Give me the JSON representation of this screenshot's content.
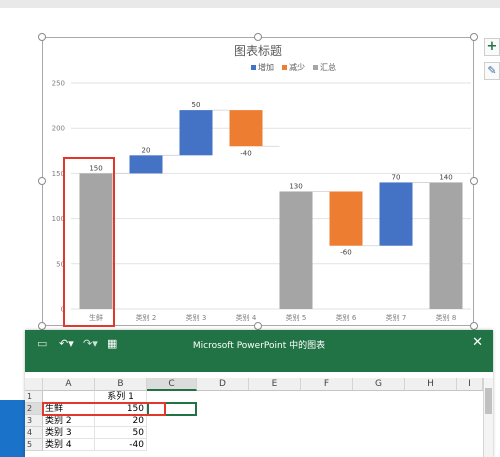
{
  "chart": {
    "title": "图表标题",
    "legend": [
      {
        "label": "增加",
        "color": "#4472c4"
      },
      {
        "label": "减少",
        "color": "#ed7d31"
      },
      {
        "label": "汇总",
        "color": "#a5a5a5"
      }
    ]
  },
  "chart_data": {
    "type": "bar",
    "subtype": "waterfall",
    "title": "图表标题",
    "ylim": [
      0,
      250
    ],
    "yticks": [
      0,
      50,
      100,
      150,
      200,
      250
    ],
    "grid": true,
    "legend_position": "top",
    "categories": [
      "生鲜",
      "类别 2",
      "类别 3",
      "类别 4",
      "类别 5",
      "类别 6",
      "类别 7",
      "类别 8"
    ],
    "values": [
      150,
      20,
      50,
      -40,
      130,
      -60,
      70,
      140
    ],
    "bar_kind": [
      "total",
      "increase",
      "increase",
      "decrease",
      "total",
      "decrease",
      "increase",
      "total"
    ],
    "data_labels": [
      "150",
      "20",
      "50",
      "-40",
      "130",
      "-60",
      "70",
      "140"
    ]
  },
  "spreadsheet": {
    "window_title": "Microsoft PowerPoint 中的图表",
    "close_glyph": "✕",
    "columns": [
      "A",
      "B",
      "C",
      "D",
      "E",
      "F",
      "G",
      "H",
      "I"
    ],
    "header_series": "系列 1",
    "rows": [
      {
        "num": "1",
        "a": "",
        "b": "系列 1"
      },
      {
        "num": "2",
        "a": "生鲜",
        "b": "150"
      },
      {
        "num": "3",
        "a": "类别 2",
        "b": "20"
      },
      {
        "num": "4",
        "a": "类别 3",
        "b": "50"
      },
      {
        "num": "5",
        "a": "类别 4",
        "b": "-40"
      }
    ]
  },
  "side_buttons": {
    "plus_icon": "chart-elements-icon",
    "brush_icon": "chart-styles-icon"
  },
  "colors": {
    "increase": "#4472c4",
    "decrease": "#ed7d31",
    "total": "#a5a5a5",
    "highlight": "#e0392b",
    "excel_green": "#217346"
  }
}
